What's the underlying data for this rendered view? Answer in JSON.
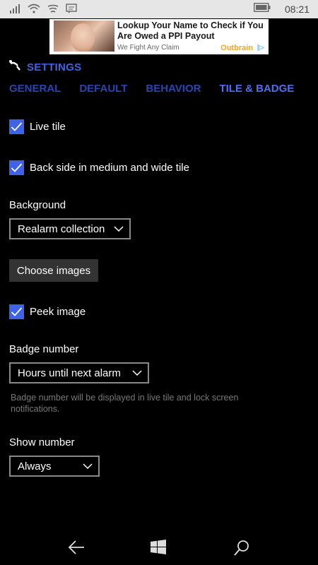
{
  "status_bar": {
    "time": "08:21",
    "icons": [
      "signal-icon",
      "wifi-icon",
      "wifi-alt-icon",
      "message-icon",
      "battery-icon"
    ]
  },
  "ad": {
    "headline": "Lookup Your Name to Check if You Are Owed a PPI Payout",
    "sponsor": "We Fight Any Claim",
    "brand": "Outbrain",
    "choice_label": "|▷"
  },
  "header": {
    "title": "SETTINGS",
    "icon": "alarm-bell-icon",
    "accent_color": "#3e63e8"
  },
  "tabs": [
    {
      "label": "GENERAL",
      "active": false
    },
    {
      "label": "DEFAULT",
      "active": false
    },
    {
      "label": "BEHAVIOR",
      "active": false
    },
    {
      "label": "TILE & BADGE",
      "active": true
    }
  ],
  "settings": {
    "live_tile": {
      "label": "Live tile",
      "checked": true
    },
    "back_side": {
      "label": "Back side in medium and wide tile",
      "checked": true
    },
    "background": {
      "label": "Background",
      "value": "Realarm collection"
    },
    "choose_images": {
      "label": "Choose images"
    },
    "peek_image": {
      "label": "Peek image",
      "checked": true
    },
    "badge_number": {
      "label": "Badge number",
      "value": "Hours until next alarm",
      "help": "Badge number will be displayed in live tile and lock screen notifications."
    },
    "show_number": {
      "label": "Show number",
      "value": "Always"
    }
  },
  "nav_bar": {
    "icons": [
      "back-arrow-icon",
      "windows-start-icon",
      "search-icon"
    ]
  }
}
